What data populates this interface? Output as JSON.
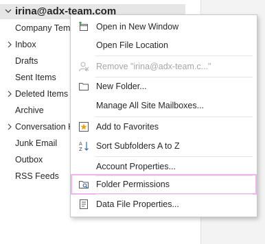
{
  "account": {
    "name": "irina@adx-team.com"
  },
  "folders": [
    {
      "label": "Company Temp",
      "chevron": false
    },
    {
      "label": "Inbox",
      "chevron": true
    },
    {
      "label": "Drafts",
      "chevron": false
    },
    {
      "label": "Sent Items",
      "chevron": false
    },
    {
      "label": "Deleted Items",
      "chevron": true
    },
    {
      "label": "Archive",
      "chevron": false
    },
    {
      "label": "Conversation H",
      "chevron": true
    },
    {
      "label": "Junk Email",
      "chevron": false
    },
    {
      "label": "Outbox",
      "chevron": false
    },
    {
      "label": "RSS Feeds",
      "chevron": false
    }
  ],
  "menu": {
    "items": [
      {
        "label": "Open in New Window",
        "icon": "new-window-icon",
        "disabled": false
      },
      {
        "label": "Open File Location",
        "icon": "",
        "disabled": false
      },
      {
        "label": "Remove \"irina@adx-team.c...\"",
        "icon": "remove-user-icon",
        "disabled": true
      },
      {
        "label": "New Folder...",
        "icon": "folder-icon",
        "disabled": false
      },
      {
        "label": "Manage All Site Mailboxes...",
        "icon": "",
        "disabled": false
      },
      {
        "label": "Add to Favorites",
        "icon": "favorites-star-icon",
        "disabled": false
      },
      {
        "label": "Sort Subfolders A to Z",
        "icon": "sort-az-icon",
        "disabled": false
      },
      {
        "label": "Account Properties...",
        "icon": "",
        "disabled": false
      },
      {
        "label": "Folder Permissions",
        "icon": "folder-permissions-icon",
        "disabled": false
      },
      {
        "label": "Data File Properties...",
        "icon": "data-file-icon",
        "disabled": false
      }
    ],
    "highlight_color": "#f0b4ee"
  }
}
